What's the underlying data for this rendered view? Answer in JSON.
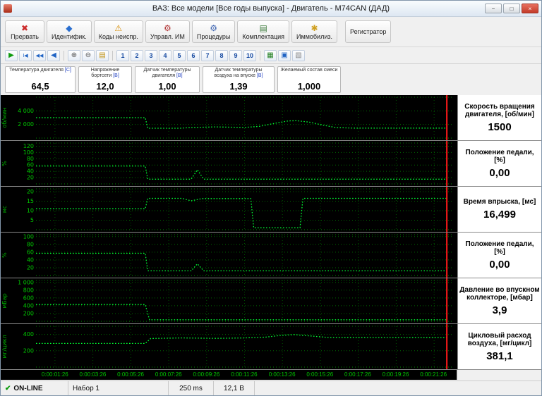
{
  "window": {
    "title": "ВАЗ: Все модели [Все годы выпуска] - Двигатель - M74CAN (ДАД)",
    "minimize_glyph": "−",
    "maximize_glyph": "□",
    "close_glyph": "×"
  },
  "toolbar": {
    "buttons": [
      {
        "name": "abort",
        "label": "Прервать",
        "glyph": "✖",
        "color": "#cc2b2b"
      },
      {
        "name": "identify",
        "label": "Идентифик.",
        "glyph": "◆",
        "color": "#2a6fd0"
      },
      {
        "name": "trouble-codes",
        "label": "Коды неиспр.",
        "glyph": "⚠",
        "color": "#d78c00"
      },
      {
        "name": "actuators",
        "label": "Управл. ИМ",
        "glyph": "⚙",
        "color": "#b03030"
      },
      {
        "name": "procedures",
        "label": "Процедуры",
        "glyph": "⚙",
        "color": "#3a62b0"
      },
      {
        "name": "equipment",
        "label": "Комплектация",
        "glyph": "▤",
        "color": "#3a7a3a"
      },
      {
        "name": "immobilizer",
        "label": "Иммобилиз.",
        "glyph": "✱",
        "color": "#d0a020"
      },
      {
        "name": "recorder",
        "label": "Регистратор",
        "glyph": "",
        "color": ""
      }
    ]
  },
  "playback": {
    "items": [
      {
        "name": "play-icon",
        "glyph": "▶",
        "color": "#0d9a0d"
      },
      {
        "name": "skip-start-icon",
        "glyph": "Ι◀",
        "color": "#1f63c4"
      },
      {
        "name": "rewind-icon",
        "glyph": "◀◀",
        "color": "#1f63c4"
      },
      {
        "name": "step-back-icon",
        "glyph": "◀",
        "color": "#1f63c4"
      },
      {
        "name": "separator"
      },
      {
        "name": "zoom-in-icon",
        "glyph": "⊕",
        "color": "#555555"
      },
      {
        "name": "zoom-out-icon",
        "glyph": "⊖",
        "color": "#555555"
      },
      {
        "name": "copy-page-icon",
        "glyph": "▤",
        "color": "#c09010"
      },
      {
        "name": "separator"
      },
      {
        "name": "channel-1",
        "glyph": "1",
        "num": true
      },
      {
        "name": "channel-2",
        "glyph": "2",
        "num": true
      },
      {
        "name": "channel-3",
        "glyph": "3",
        "num": true
      },
      {
        "name": "channel-4",
        "glyph": "4",
        "num": true
      },
      {
        "name": "channel-5",
        "glyph": "5",
        "num": true
      },
      {
        "name": "channel-6",
        "glyph": "6",
        "num": true
      },
      {
        "name": "channel-7",
        "glyph": "7",
        "num": true
      },
      {
        "name": "channel-8",
        "glyph": "8",
        "num": true
      },
      {
        "name": "channel-9",
        "glyph": "9",
        "num": true
      },
      {
        "name": "channel-10",
        "glyph": "10",
        "num": true
      },
      {
        "name": "separator"
      },
      {
        "name": "export-table-icon",
        "glyph": "▦",
        "color": "#1e7e1e"
      },
      {
        "name": "save-icon",
        "glyph": "▣",
        "color": "#1f63c4"
      },
      {
        "name": "record-icon",
        "glyph": "▧",
        "color": "#888888"
      }
    ]
  },
  "parameters": [
    {
      "label": "Температура двигателя",
      "unit": "[С]",
      "value": "64,5"
    },
    {
      "label": "Напряжение бортсети",
      "unit": "[В]",
      "value": "12,0"
    },
    {
      "label": "Датчик температуры двигателя",
      "unit": "[В]",
      "value": "1,00"
    },
    {
      "label": "Датчик температуры воздуха на впуске",
      "unit": "[В]",
      "value": "1,39"
    },
    {
      "label": "Желаемый состав смеси",
      "unit": "",
      "value": "1,000"
    }
  ],
  "chart_data": {
    "type": "line",
    "grid": true,
    "background": "#000000",
    "trace_color": "#00ff33",
    "grid_color": "#006a00",
    "cursor_color": "#ff1a1a",
    "cursor_x": 0.985,
    "time_labels": [
      "0:00:01:26",
      "0:00:03:26",
      "0:00:05:26",
      "0:00:07:26",
      "0:00:09:26",
      "0:00:11:26",
      "0:00:13:26",
      "0:00:15:26",
      "0:00:17:26",
      "0:00:19:26",
      "0:00:21:26"
    ],
    "strips": [
      {
        "name": "engine-speed",
        "title": "Скорость вращения двигателя, [об/мин]",
        "value": "1500",
        "unit": "об/мин",
        "ymax": 6000,
        "ticks": [
          {
            "v": 2000,
            "label": "2 000"
          },
          {
            "v": 4000,
            "label": "4 000"
          }
        ],
        "points": [
          [
            0,
            3000
          ],
          [
            0.262,
            3000
          ],
          [
            0.268,
            1450
          ],
          [
            0.345,
            1450
          ],
          [
            0.375,
            1560
          ],
          [
            0.43,
            1640
          ],
          [
            0.465,
            1600
          ],
          [
            0.5,
            1570
          ],
          [
            0.535,
            1720
          ],
          [
            0.575,
            2200
          ],
          [
            0.605,
            2520
          ],
          [
            0.625,
            2550
          ],
          [
            0.655,
            2350
          ],
          [
            0.69,
            1880
          ],
          [
            0.72,
            1540
          ],
          [
            0.76,
            1470
          ],
          [
            0.985,
            1470
          ]
        ]
      },
      {
        "name": "pedal-position-1",
        "title": "Положение педали, [%]",
        "value": "0,00",
        "unit": "%",
        "ymax": 130,
        "ticks": [
          {
            "v": 20,
            "label": "20"
          },
          {
            "v": 40,
            "label": "40"
          },
          {
            "v": 60,
            "label": "60"
          },
          {
            "v": 80,
            "label": "80"
          },
          {
            "v": 100,
            "label": "100"
          },
          {
            "v": 120,
            "label": "120"
          }
        ],
        "points": [
          [
            0,
            57
          ],
          [
            0.262,
            57
          ],
          [
            0.268,
            15
          ],
          [
            0.372,
            15
          ],
          [
            0.387,
            45
          ],
          [
            0.402,
            15
          ],
          [
            0.985,
            15
          ]
        ]
      },
      {
        "name": "injection-time",
        "title": "Время впрыска, [мс]",
        "value": "16,499",
        "unit": "мс",
        "ymax": 21.5,
        "ticks": [
          {
            "v": 5,
            "label": "5"
          },
          {
            "v": 10,
            "label": "10"
          },
          {
            "v": 15,
            "label": "15"
          },
          {
            "v": 20,
            "label": "20"
          }
        ],
        "points": [
          [
            0,
            11
          ],
          [
            0.262,
            11
          ],
          [
            0.268,
            16.5
          ],
          [
            0.35,
            16.5
          ],
          [
            0.372,
            15.2
          ],
          [
            0.398,
            16.4
          ],
          [
            0.515,
            16.4
          ],
          [
            0.522,
            1
          ],
          [
            0.633,
            1
          ],
          [
            0.64,
            16.5
          ],
          [
            0.985,
            16.5
          ]
        ]
      },
      {
        "name": "pedal-position-2",
        "title": "Положение педали, [%]",
        "value": "0,00",
        "unit": "%",
        "ymax": 105,
        "ticks": [
          {
            "v": 20,
            "label": "20"
          },
          {
            "v": 40,
            "label": "40"
          },
          {
            "v": 60,
            "label": "60"
          },
          {
            "v": 80,
            "label": "80"
          },
          {
            "v": 100,
            "label": "100"
          }
        ],
        "points": [
          [
            0,
            57
          ],
          [
            0.262,
            57
          ],
          [
            0.268,
            12
          ],
          [
            0.372,
            12
          ],
          [
            0.387,
            30
          ],
          [
            0.402,
            12
          ],
          [
            0.985,
            12
          ]
        ]
      },
      {
        "name": "manifold-pressure",
        "title": "Давление во впускном коллекторе, [мбар]",
        "value": "3,9",
        "unit": "мБар",
        "ymax": 1050,
        "ticks": [
          {
            "v": 200,
            "label": "200"
          },
          {
            "v": 400,
            "label": "400"
          },
          {
            "v": 600,
            "label": "600"
          },
          {
            "v": 800,
            "label": "800"
          },
          {
            "v": 1000,
            "label": "1 000"
          }
        ],
        "points": [
          [
            0,
            430
          ],
          [
            0.262,
            430
          ],
          [
            0.272,
            40
          ],
          [
            0.985,
            40
          ]
        ]
      },
      {
        "name": "cyclic-air-flow",
        "title": "Цикловый расход воздуха, [мг/цикл]",
        "value": "381,1",
        "unit": "мг/цикл",
        "ymax": 500,
        "ticks": [
          {
            "v": 200,
            "label": "200"
          },
          {
            "v": 400,
            "label": "400"
          }
        ],
        "points": [
          [
            0,
            290
          ],
          [
            0.262,
            290
          ],
          [
            0.275,
            350
          ],
          [
            0.35,
            357
          ],
          [
            0.43,
            352
          ],
          [
            0.5,
            357
          ],
          [
            0.55,
            366
          ],
          [
            0.59,
            390
          ],
          [
            0.62,
            397
          ],
          [
            0.66,
            380
          ],
          [
            0.7,
            363
          ],
          [
            0.985,
            361
          ]
        ]
      }
    ]
  },
  "status": {
    "check_glyph": "✔",
    "online": "ON-LINE",
    "dataset": "Набор 1",
    "interval": "250 ms",
    "voltage": "12,1 В"
  }
}
